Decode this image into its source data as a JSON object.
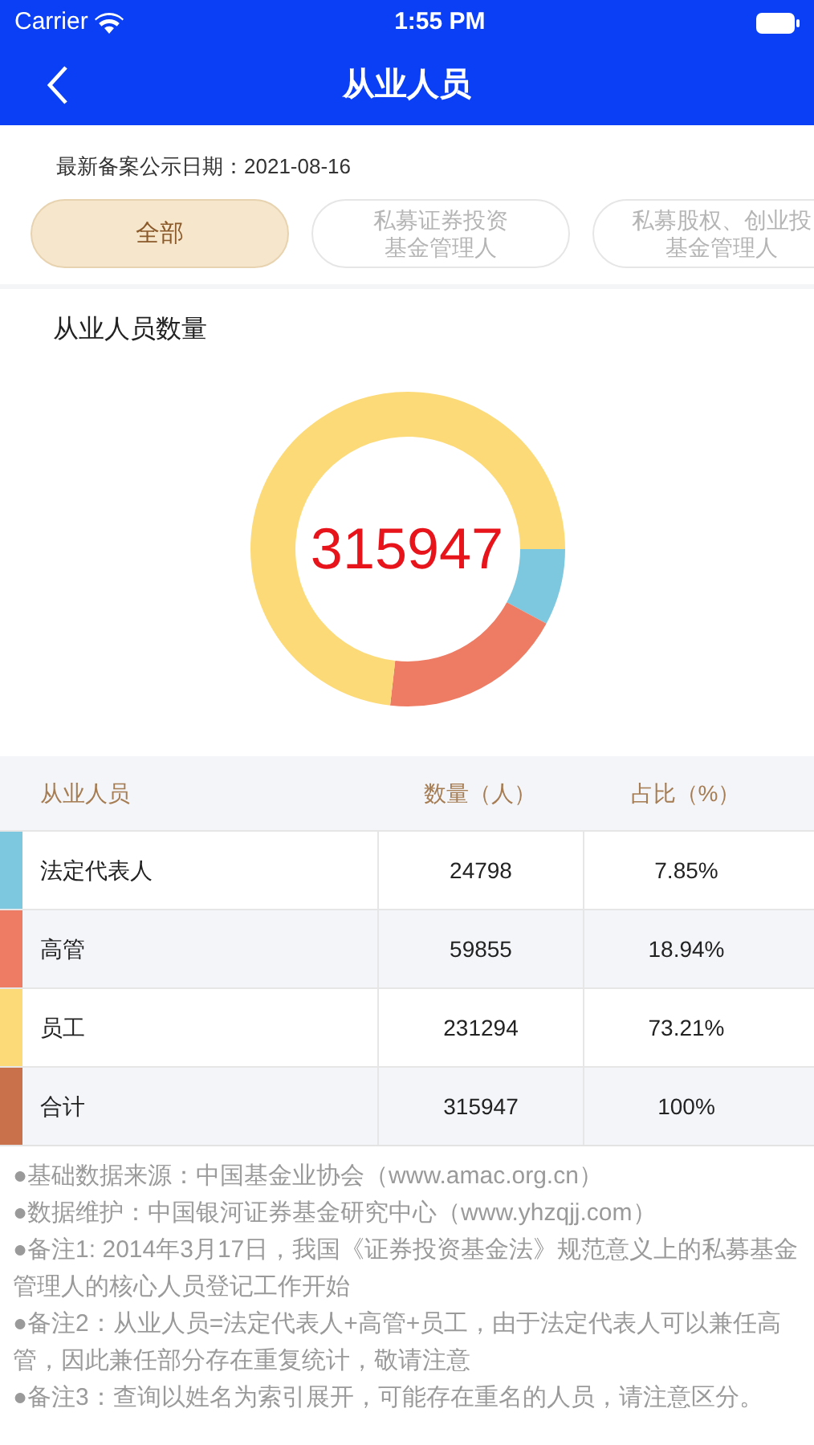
{
  "status_bar": {
    "carrier": "Carrier",
    "time": "1:55 PM"
  },
  "nav": {
    "title": "从业人员"
  },
  "date_line": "最新备案公示日期：2021-08-16",
  "tabs": [
    {
      "lines": [
        "全部"
      ],
      "selected": true
    },
    {
      "lines": [
        "私募证券投资",
        "基金管理人"
      ],
      "selected": false
    },
    {
      "lines": [
        "私募股权、创业投",
        "基金管理人"
      ],
      "selected": false
    }
  ],
  "chart_section": {
    "title": "从业人员数量",
    "center_value": "315947",
    "chart_data": {
      "type": "donut",
      "values": [
        7.85,
        18.94,
        73.21
      ],
      "colors": [
        "#7ec8df",
        "#ee7b63",
        "#fdda78"
      ]
    }
  },
  "table": {
    "columns": [
      "从业人员",
      "数量（人）",
      "占比（%）"
    ],
    "rows": [
      {
        "cells": [
          "法定代表人",
          "24798",
          "7.85%"
        ],
        "color": "#7ec8df"
      },
      {
        "cells": [
          "高管",
          "59855",
          "18.94%"
        ],
        "color": "#ee7b63"
      },
      {
        "cells": [
          "员工",
          "231294",
          "73.21%"
        ],
        "color": "#fdda78"
      },
      {
        "cells": [
          "合计",
          "315947",
          "100%"
        ],
        "color": "#c8714a"
      }
    ]
  },
  "notes": [
    "●基础数据来源：中国基金业协会（www.amac.org.cn）",
    "●数据维护：中国银河证券基金研究中心（www.yhzqjj.com）",
    "●备注1: 2014年3月17日，我国《证券投资基金法》规范意义上的私募基金管理人的核心人员登记工作开始",
    "●备注2：从业人员=法定代表人+高管+员工，由于法定代表人可以兼任高管，因此兼任部分存在重复统计，敬请注意",
    "●备注3：查询以姓名为索引展开，可能存在重名的人员，请注意区分。"
  ]
}
